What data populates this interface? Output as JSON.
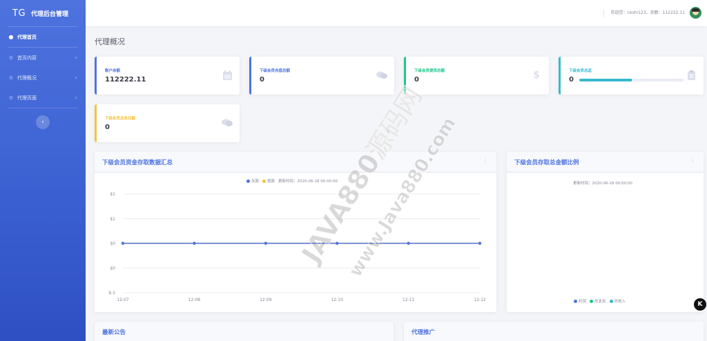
{
  "sidebar": {
    "brand_prefix": "TG",
    "brand_name": "代理后台管理",
    "home_label": "代理首页",
    "items": [
      {
        "label": "首页内容"
      },
      {
        "label": "代理概况"
      },
      {
        "label": "代理页面"
      }
    ]
  },
  "header": {
    "welcome": "欢迎您：ceshi123，余额：112222.11"
  },
  "page": {
    "title": "代理概况"
  },
  "stats": [
    {
      "label": "账户余额",
      "value": "112222.11",
      "icon": "calendar-icon",
      "color": "#4e73df"
    },
    {
      "label": "下级会员充值总额",
      "value": "0",
      "icon": "comments-icon",
      "color": "#4e73df"
    },
    {
      "label": "下级会员提现总额",
      "value": "0",
      "icon": "dollar-icon",
      "color": "#1cc88a"
    },
    {
      "label": "下级会员总返",
      "value": "0",
      "icon": "clipboard-icon",
      "color": "#36b9cc",
      "progress": 0.5
    },
    {
      "label": "下级会员总体总额",
      "value": "0",
      "icon": "comments-icon",
      "color": "#f6c23e"
    }
  ],
  "panels": {
    "trend_title": "下级会员资金存取数据汇总",
    "ratio_title": "下级会员存取总金额比例",
    "notice_title": "最新公告",
    "promo_title": "代理推广"
  },
  "trend_legend": {
    "deposit": "存款",
    "withdraw": "提款",
    "update_time": "更新时间：2020-06-18 00:00:00"
  },
  "ratio_update_time": "更新时间：2020-06-18 00:00:00",
  "ratio_legend": [
    "利润",
    "总支出",
    "总收入"
  ],
  "colors": {
    "primary": "#4e73df",
    "success": "#1cc88a",
    "info": "#36b9cc",
    "warning": "#f6c23e"
  },
  "watermark": {
    "line1": "JAVA880源码网",
    "line2": "www.Java880.com"
  },
  "chart_data": {
    "type": "line",
    "categories": [
      "12-07",
      "12-08",
      "12-09",
      "12-10",
      "12-11",
      "12-12"
    ],
    "series": [
      {
        "name": "存款",
        "values": [
          0,
          0,
          0,
          0,
          0,
          0
        ]
      },
      {
        "name": "提款",
        "values": [
          0,
          0,
          0,
          0,
          0,
          0
        ]
      }
    ],
    "y_tick_labels": [
      "$1",
      "$1",
      "$0",
      "$0",
      "$-1"
    ],
    "ylim": [
      -1,
      1
    ],
    "grid": true,
    "legend": "top-center"
  }
}
